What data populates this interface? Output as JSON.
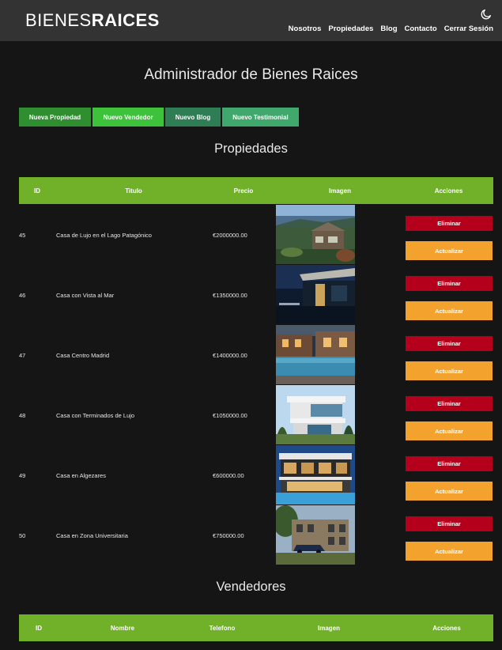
{
  "header": {
    "logo_light": "BIENES",
    "logo_bold": "RAICES",
    "nav": [
      "Nosotros",
      "Propiedades",
      "Blog",
      "Contacto",
      "Cerrar Sesión"
    ]
  },
  "page_title": "Administrador de Bienes Raices",
  "buttons": {
    "new_property": "Nueva Propiedad",
    "new_seller": "Nuevo Vendedor",
    "new_blog": "Nuevo Blog",
    "new_testimonial": "Nuevo Testimonial"
  },
  "properties": {
    "title": "Propiedades",
    "headers": [
      "ID",
      "Titulo",
      "Precio",
      "Imagen",
      "Acciones"
    ],
    "rows": [
      {
        "id": "45",
        "title": "Casa de Lujo en el Lago Patagónico",
        "price": "€2000000.00"
      },
      {
        "id": "46",
        "title": "Casa con Vista al Mar",
        "price": "€1350000.00"
      },
      {
        "id": "47",
        "title": "Casa Centro Madrid",
        "price": "€1400000.00"
      },
      {
        "id": "48",
        "title": "Casa con Terminados de Lujo",
        "price": "€1050000.00"
      },
      {
        "id": "49",
        "title": "Casa en Algezares",
        "price": "€600000.00"
      },
      {
        "id": "50",
        "title": "Casa en Zona Universitaria",
        "price": "€750000.00"
      }
    ],
    "delete_label": "Eliminar",
    "update_label": "Actualizar"
  },
  "sellers": {
    "title": "Vendedores",
    "headers": [
      "ID",
      "Nombre",
      "Telefono",
      "Imagen",
      "Acciones"
    ]
  },
  "colors": {
    "header_bg": "#333333",
    "page_bg": "#151515",
    "table_head": "#71b12a",
    "delete": "#b5001b",
    "update": "#f3a22e",
    "btn_new_property": "#2f8f30",
    "btn_new_seller": "#3ec13b",
    "btn_new_blog": "#2e7d54",
    "btn_new_testimonial": "#41a86d"
  }
}
